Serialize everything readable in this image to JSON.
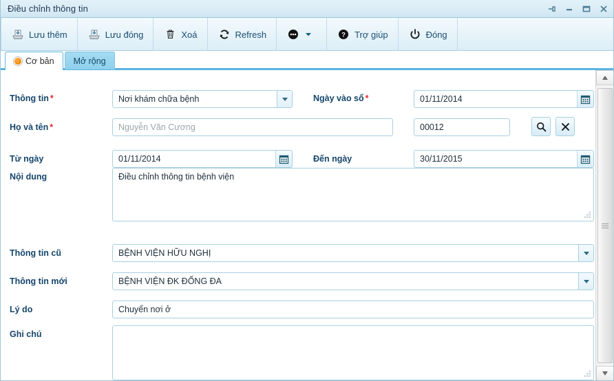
{
  "window": {
    "title": "Điều chỉnh thông tin",
    "controls": [
      {
        "name": "pin-icon",
        "label": "Pin"
      },
      {
        "name": "minimize-icon",
        "label": "Minimize"
      },
      {
        "name": "maximize-icon",
        "label": "Maximize"
      },
      {
        "name": "close-icon",
        "label": "Close"
      }
    ]
  },
  "toolbar": {
    "save_add_label": "Lưu thêm",
    "save_close_label": "Lưu đóng",
    "delete_label": "Xoá",
    "refresh_label": "Refresh",
    "more_label": "",
    "help_label": "Trợ giúp",
    "close_label": "Đóng"
  },
  "tabs": [
    {
      "label": "Cơ bản",
      "active": true
    },
    {
      "label": "Mở rộng",
      "active": false
    }
  ],
  "form": {
    "info_type": {
      "label": "Thông tin",
      "required": "*",
      "value": "Nơi khám chữa bệnh"
    },
    "entry_date": {
      "label": "Ngày vào sổ",
      "required": "*",
      "value": "01/11/2014"
    },
    "full_name": {
      "label": "Họ và tên",
      "required": "*",
      "placeholder": "Nguyễn Văn Cương",
      "value": ""
    },
    "code": {
      "label": "",
      "value": "00012"
    },
    "from_date": {
      "label": "Từ ngày",
      "value": "01/11/2014"
    },
    "to_date": {
      "label": "Đến ngày",
      "value": "30/11/2015"
    },
    "content": {
      "label": "Nội dung",
      "value": "Điều chỉnh thông tin bệnh viện"
    },
    "old_info": {
      "label": "Thông tin cũ",
      "value": "BỆNH VIỆN HỮU NGHỊ"
    },
    "new_info": {
      "label": "Thông tin mới",
      "value": "BỆNH VIỆN ĐK ĐỐNG ĐA"
    },
    "reason": {
      "label": "Lý do",
      "value": "Chuyển nơi ở"
    },
    "note": {
      "label": "Ghi chú",
      "value": ""
    }
  },
  "colors": {
    "accent": "#59b4e0",
    "label": "#16456b",
    "required": "#e8262d",
    "tab_active_bg": "#ffffff",
    "tab_inactive_bg": "#8ed0ec",
    "field_border": "#a9cfe0",
    "radio_orange": "#f08a00"
  }
}
